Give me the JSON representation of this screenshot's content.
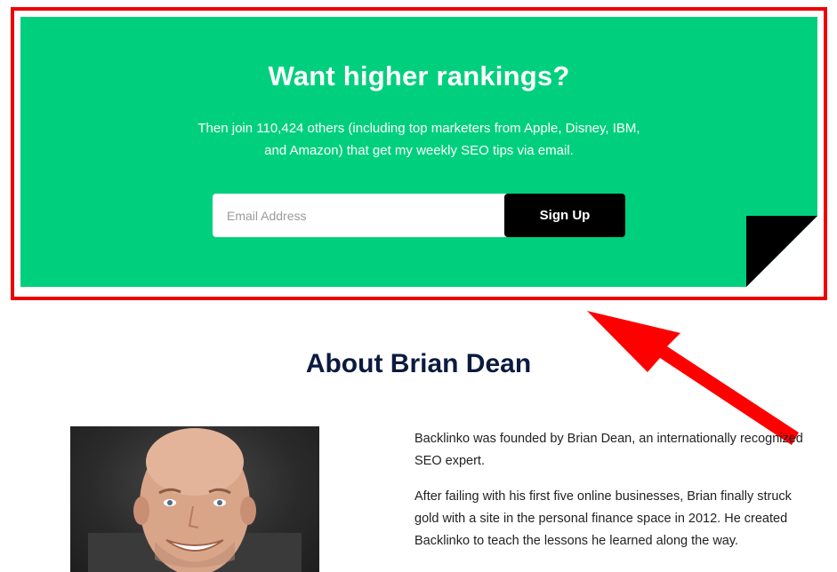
{
  "optin": {
    "title": "Want higher rankings?",
    "text": "Then join 110,424 others (including top marketers from Apple, Disney, IBM, and Amazon) that get my weekly SEO tips via email.",
    "email_placeholder": "Email Address",
    "signup_label": "Sign Up",
    "background_color": "#00d07d",
    "highlight_color": "#ee0000"
  },
  "about": {
    "title": "About Brian Dean",
    "bio": [
      "Backlinko was founded by Brian Dean, an internationally recognized SEO expert.",
      "After failing with his first five online businesses, Brian finally struck gold with a site in the personal finance space in 2012. He created Backlinko to teach the lessons he learned along the way."
    ]
  },
  "icons": {
    "annotation_arrow": "red-arrow-icon",
    "page_curl": "page-curl-icon",
    "photo": "brian-dean-photo"
  }
}
